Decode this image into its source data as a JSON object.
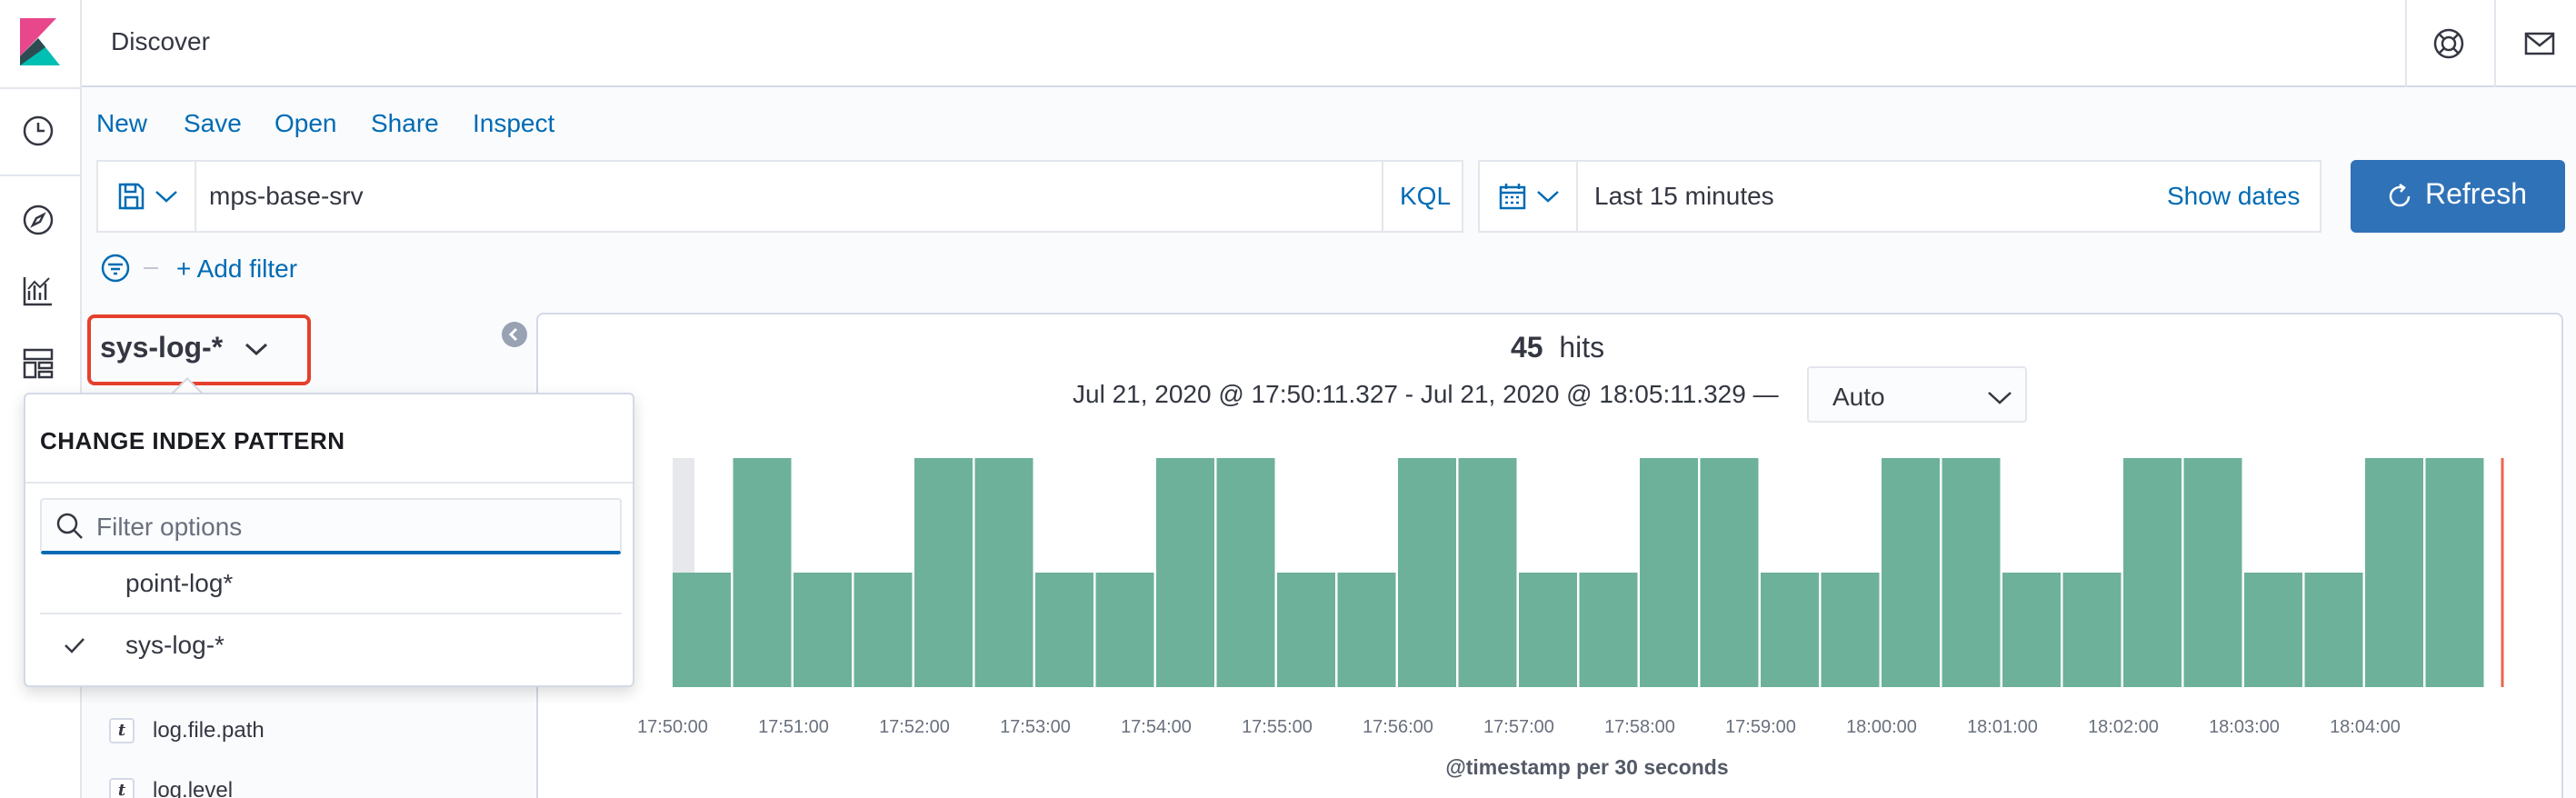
{
  "app": {
    "title": "Discover"
  },
  "nav": {
    "icons": [
      "kibana-logo",
      "clock-icon",
      "compass-icon",
      "visualize-icon",
      "dashboard-icon"
    ]
  },
  "header": {
    "icons": [
      "help-icon",
      "mail-icon"
    ]
  },
  "top_menu": {
    "items": [
      {
        "label": "New"
      },
      {
        "label": "Save"
      },
      {
        "label": "Open"
      },
      {
        "label": "Share"
      },
      {
        "label": "Inspect"
      }
    ]
  },
  "query": {
    "value": "mps-base-srv",
    "language_label": "KQL"
  },
  "date_picker": {
    "range_label": "Last 15 minutes",
    "show_dates_label": "Show dates"
  },
  "refresh": {
    "label": "Refresh"
  },
  "filter": {
    "add_label": "+ Add filter"
  },
  "sidebar": {
    "index_pattern": "sys-log-*",
    "fields": [
      {
        "type": "t",
        "name": "log.file.path"
      },
      {
        "type": "t",
        "name": "log.level"
      }
    ]
  },
  "popover": {
    "title": "CHANGE INDEX PATTERN",
    "search_placeholder": "Filter options",
    "options": [
      {
        "label": "point-log*",
        "checked": false
      },
      {
        "label": "sys-log-*",
        "checked": true
      }
    ]
  },
  "histogram": {
    "hits_count": "45",
    "hits_label": "hits",
    "range_text": "Jul 21, 2020 @ 17:50:11.327 - Jul 21, 2020 @ 18:05:11.329 —",
    "interval": "Auto"
  },
  "colors": {
    "bar": "#6db19a",
    "accent": "#006bb4",
    "refresh_button": "#3072b7",
    "highlight_border": "#e5402d",
    "now_line": "#e7664c"
  },
  "chart_data": {
    "type": "bar",
    "title": "",
    "xlabel": "@timestamp per 30 seconds",
    "ylabel": "",
    "tick_labels": [
      "17:50:00",
      "17:51:00",
      "17:52:00",
      "17:53:00",
      "17:54:00",
      "17:55:00",
      "17:56:00",
      "17:57:00",
      "17:58:00",
      "17:59:00",
      "18:00:00",
      "18:01:00",
      "18:02:00",
      "18:03:00",
      "18:04:00"
    ],
    "categories": [
      "17:50:00",
      "17:50:30",
      "17:51:00",
      "17:51:30",
      "17:52:00",
      "17:52:30",
      "17:53:00",
      "17:53:30",
      "17:54:00",
      "17:54:30",
      "17:55:00",
      "17:55:30",
      "17:56:00",
      "17:56:30",
      "17:57:00",
      "17:57:30",
      "17:58:00",
      "17:58:30",
      "17:59:00",
      "17:59:30",
      "18:00:00",
      "18:00:30",
      "18:01:00",
      "18:01:30",
      "18:02:00",
      "18:02:30",
      "18:03:00",
      "18:03:30",
      "18:04:00",
      "18:04:30"
    ],
    "values": [
      1,
      2,
      1,
      1,
      2,
      2,
      1,
      1,
      2,
      2,
      1,
      1,
      2,
      2,
      1,
      1,
      2,
      2,
      1,
      1,
      2,
      2,
      1,
      1,
      2,
      2,
      1,
      1,
      2,
      2
    ],
    "ylim": [
      0,
      2
    ],
    "grid": false,
    "legend": "none"
  }
}
